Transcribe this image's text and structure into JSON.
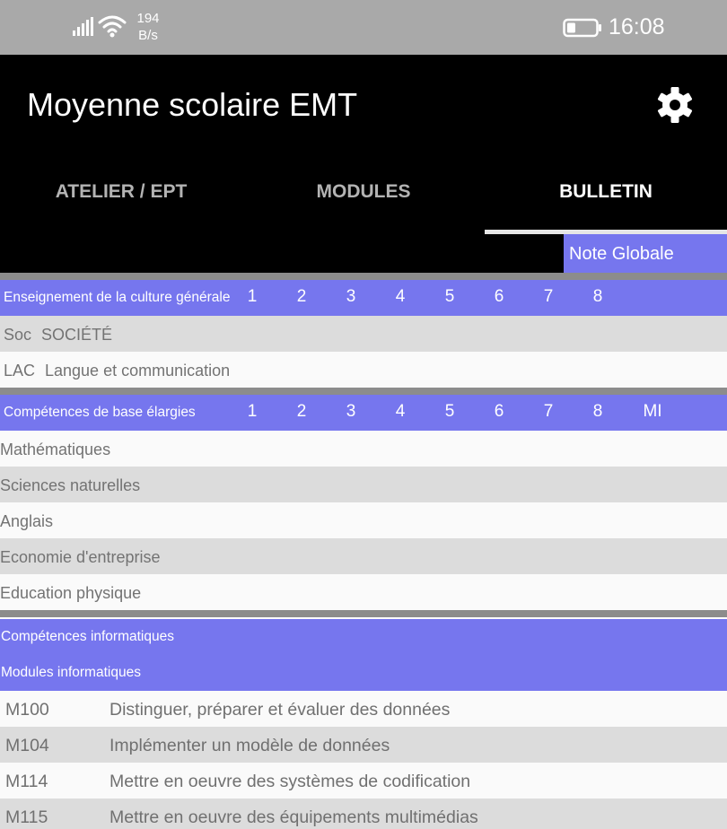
{
  "status_bar": {
    "speed_value": "194",
    "speed_unit": "B/s",
    "time": "16:08",
    "icons": [
      "signal-icon",
      "wifi-icon",
      "battery-icon"
    ]
  },
  "app_bar": {
    "title": "Moyenne scolaire EMT",
    "settings_icon": "gear-icon"
  },
  "tabs": [
    {
      "label": "ATELIER / EPT",
      "active": false
    },
    {
      "label": "MODULES",
      "active": false
    },
    {
      "label": "BULLETIN",
      "active": true
    }
  ],
  "note_globale": "Note Globale",
  "culture_generale": {
    "header": "Enseignement de la culture générale",
    "columns": [
      "1",
      "2",
      "3",
      "4",
      "5",
      "6",
      "7",
      "8"
    ],
    "rows": [
      {
        "code": "Soc",
        "name": "SOCIÉTÉ"
      },
      {
        "code": "LAC",
        "name": "Langue et communication"
      }
    ]
  },
  "competences_base": {
    "header": "Compétences de base élargies",
    "columns": [
      "1",
      "2",
      "3",
      "4",
      "5",
      "6",
      "7",
      "8",
      "MI"
    ],
    "rows": [
      "Mathématiques",
      "Sciences naturelles",
      "Anglais",
      "Economie d'entreprise",
      "Education physique"
    ]
  },
  "competences_informatiques": {
    "header": "Compétences informatiques",
    "subheader": "Modules informatiques",
    "modules": [
      {
        "code": "M100",
        "name": "Distinguer, préparer et évaluer des données"
      },
      {
        "code": "M104",
        "name": "Implémenter un modèle de données"
      },
      {
        "code": "M114",
        "name": "Mettre en oeuvre des systèmes de codification"
      },
      {
        "code": "M115",
        "name": "Mettre en oeuvre des équipements multimédias"
      }
    ]
  },
  "colors": {
    "accent": "#7676ee",
    "appbar": "#000000",
    "statusbar": "#a9a9a9",
    "row_gray": "#dcdcdc",
    "row_white": "#fafafa",
    "separator": "#8c8c8c"
  }
}
